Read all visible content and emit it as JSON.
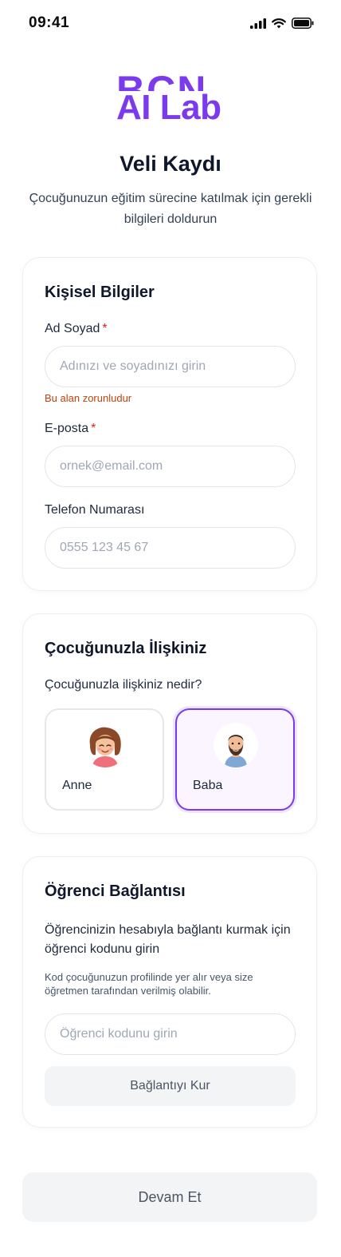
{
  "status_bar": {
    "time": "09:41"
  },
  "logo": {
    "top_text": "BCN",
    "bottom_text": "AI Lab"
  },
  "header": {
    "title": "Veli Kaydı",
    "subtitle": "Çocuğunuzun eğitim sürecine katılmak için gerekli bilgileri doldurun"
  },
  "personal_info": {
    "title": "Kişisel Bilgiler",
    "full_name": {
      "label": "Ad Soyad",
      "required_mark": "*",
      "placeholder": "Adınızı ve soyadınızı girin",
      "value": "",
      "error": "Bu alan zorunludur"
    },
    "email": {
      "label": "E-posta",
      "required_mark": "*",
      "placeholder": "ornek@email.com",
      "value": ""
    },
    "phone": {
      "label": "Telefon Numarası",
      "placeholder": "0555 123 45 67",
      "value": ""
    }
  },
  "relationship": {
    "title": "Çocuğunuzla İlişkiniz",
    "question": "Çocuğunuzla ilişkiniz nedir?",
    "options": [
      {
        "label": "Anne",
        "icon": "mother-avatar-icon",
        "selected": false
      },
      {
        "label": "Baba",
        "icon": "father-avatar-icon",
        "selected": true
      }
    ]
  },
  "student_link": {
    "title": "Öğrenci Bağlantısı",
    "description": "Öğrencinizin hesabıyla bağlantı kurmak için öğrenci kodunu girin",
    "hint": "Kod çocuğunuzun profilinde yer alır veya size öğretmen tarafından verilmiş olabilir.",
    "code_placeholder": "Öğrenci kodunu girin",
    "code_value": "",
    "connect_label": "Bağlantıyı Kur"
  },
  "continue_label": "Devam Et",
  "colors": {
    "accent": "#7c3aed",
    "error": "#c2410c",
    "required": "#dc2626",
    "button_bg": "#f3f4f6"
  }
}
